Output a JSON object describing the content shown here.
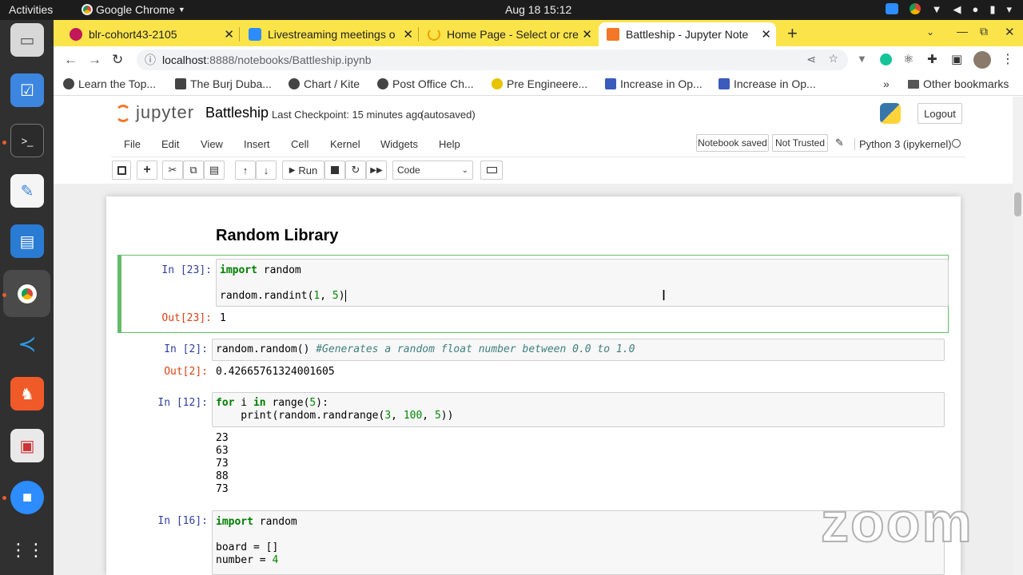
{
  "system_bar": {
    "activities": "Activities",
    "app": "Google Chrome",
    "clock": "Aug 18  15:12"
  },
  "tabs": [
    {
      "title": "blr-cohort43-2105",
      "color": "#c2185b"
    },
    {
      "title": "Livestreaming meetings o",
      "color": "#2d8cff"
    },
    {
      "title": "Home Page - Select or cre",
      "color": "#f4a000"
    },
    {
      "title": "Battleship - Jupyter Note",
      "color": "#f37726"
    }
  ],
  "new_tab": "+",
  "address": {
    "host": "localhost",
    "path": ":8888/notebooks/Battleship.ipynb"
  },
  "bookmarks": [
    "Learn the Top...",
    "The Burj Duba...",
    "Chart / Kite",
    "Post Office Ch...",
    "Pre Engineere...",
    "Increase in Op...",
    "Increase in Op..."
  ],
  "bookmarks_more": "»",
  "other_bookmarks": "Other bookmarks",
  "jupyter": {
    "logo": "jupyter",
    "notebook_name": "Battleship",
    "checkpoint": "Last Checkpoint: 15 minutes ago",
    "autosaved": "(autosaved)",
    "logout": "Logout",
    "menu": [
      "File",
      "Edit",
      "View",
      "Insert",
      "Cell",
      "Kernel",
      "Widgets",
      "Help"
    ],
    "notebook_saved": "Notebook saved",
    "not_trusted": "Not Trusted",
    "kernel": "Python 3 (ipykernel)",
    "run_label": "Run",
    "cell_type": "Code"
  },
  "notebook": {
    "heading": "Random Library",
    "cells": [
      {
        "in": "In [23]:",
        "out": "Out[23]:",
        "output": "1"
      },
      {
        "in": "In [2]:",
        "out": "Out[2]:",
        "output": "0.42665761324001605"
      },
      {
        "in": "In [12]:",
        "output": "23\n63\n73\n88\n73"
      },
      {
        "in": "In [16]:"
      }
    ]
  },
  "watermark": "zoom"
}
